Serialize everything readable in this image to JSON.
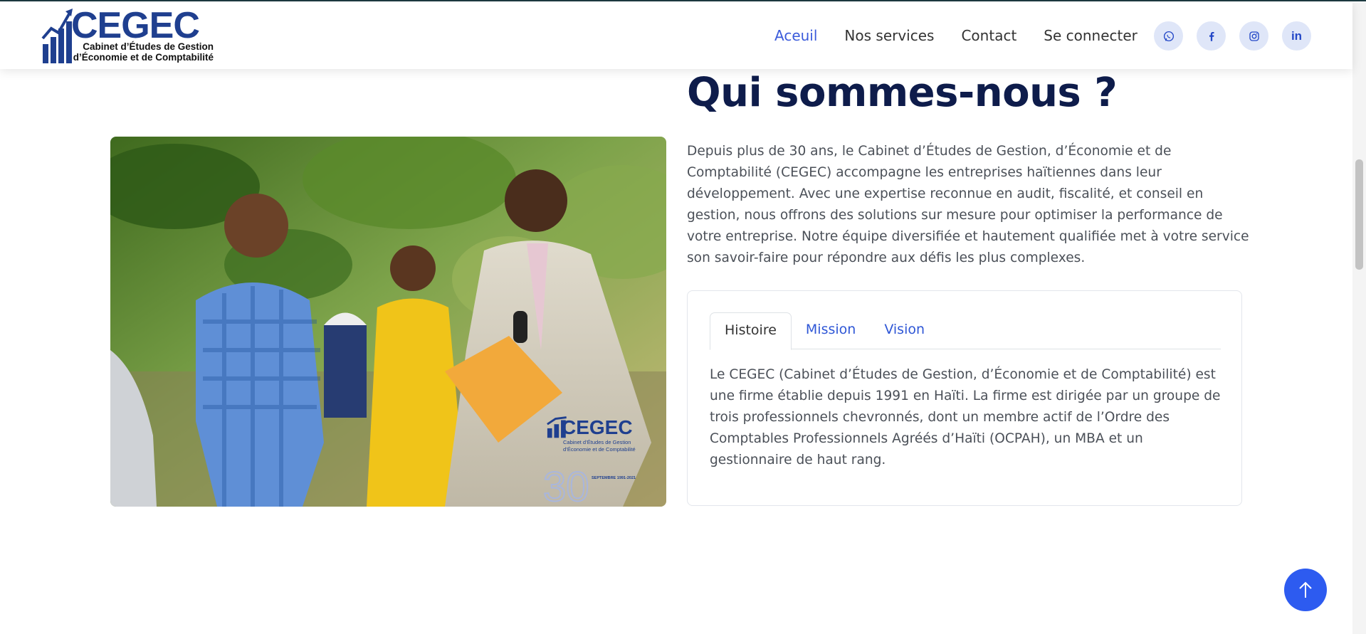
{
  "header": {
    "logo": {
      "word": "CEGEC",
      "subtitle_line1": "Cabinet d’Études de Gestion",
      "subtitle_line2": "d’Économie et de Comptabilité"
    },
    "nav": [
      {
        "label": "Aceuil",
        "active": true
      },
      {
        "label": "Nos services",
        "active": false
      },
      {
        "label": "Contact",
        "active": false
      },
      {
        "label": "Se connecter",
        "active": false
      }
    ],
    "socials": [
      "whatsapp-icon",
      "facebook-icon",
      "instagram-icon",
      "linkedin-icon"
    ]
  },
  "about": {
    "title": "Qui sommes-nous ?",
    "intro": "Depuis plus de 30 ans, le Cabinet d’Études de Gestion, d’Économie et de Comptabilité (CEGEC) accompagne les entreprises haïtiennes dans leur développement. Avec une expertise reconnue en audit, fiscalité, et conseil en gestion, nous offrons des solutions sur mesure pour optimiser la performance de votre entreprise. Notre équipe diversifiée et hautement qualifiée met à votre service son savoir-faire pour répondre aux défis les plus complexes.",
    "tabs": [
      {
        "label": "Histoire",
        "active": true
      },
      {
        "label": "Mission",
        "active": false
      },
      {
        "label": "Vision",
        "active": false
      }
    ],
    "tab_content": "Le CEGEC (Cabinet d’Études de Gestion, d’Économie et de Comptabilité) est une firme établie depuis 1991 en Haïti. La firme est dirigée par un groupe de trois professionnels chevronnés, dont un membre actif de l’Ordre des Comptables Professionnels Agréés d’Haïti (OCPAH), un MBA et un gestionnaire de haut rang.",
    "photo": {
      "watermark_word": "CEGEC",
      "watermark_sub1": "Cabinet d’Études de Gestion",
      "watermark_sub2": "d’Économie et de Comptabilité",
      "anniversary_number": "30",
      "anniversary_text": "SEPTEMBRE 1991-2021"
    }
  },
  "colors": {
    "accent": "#3b5bdb",
    "title": "#0e1c4b",
    "back_to_top": "#2d5bf0"
  }
}
